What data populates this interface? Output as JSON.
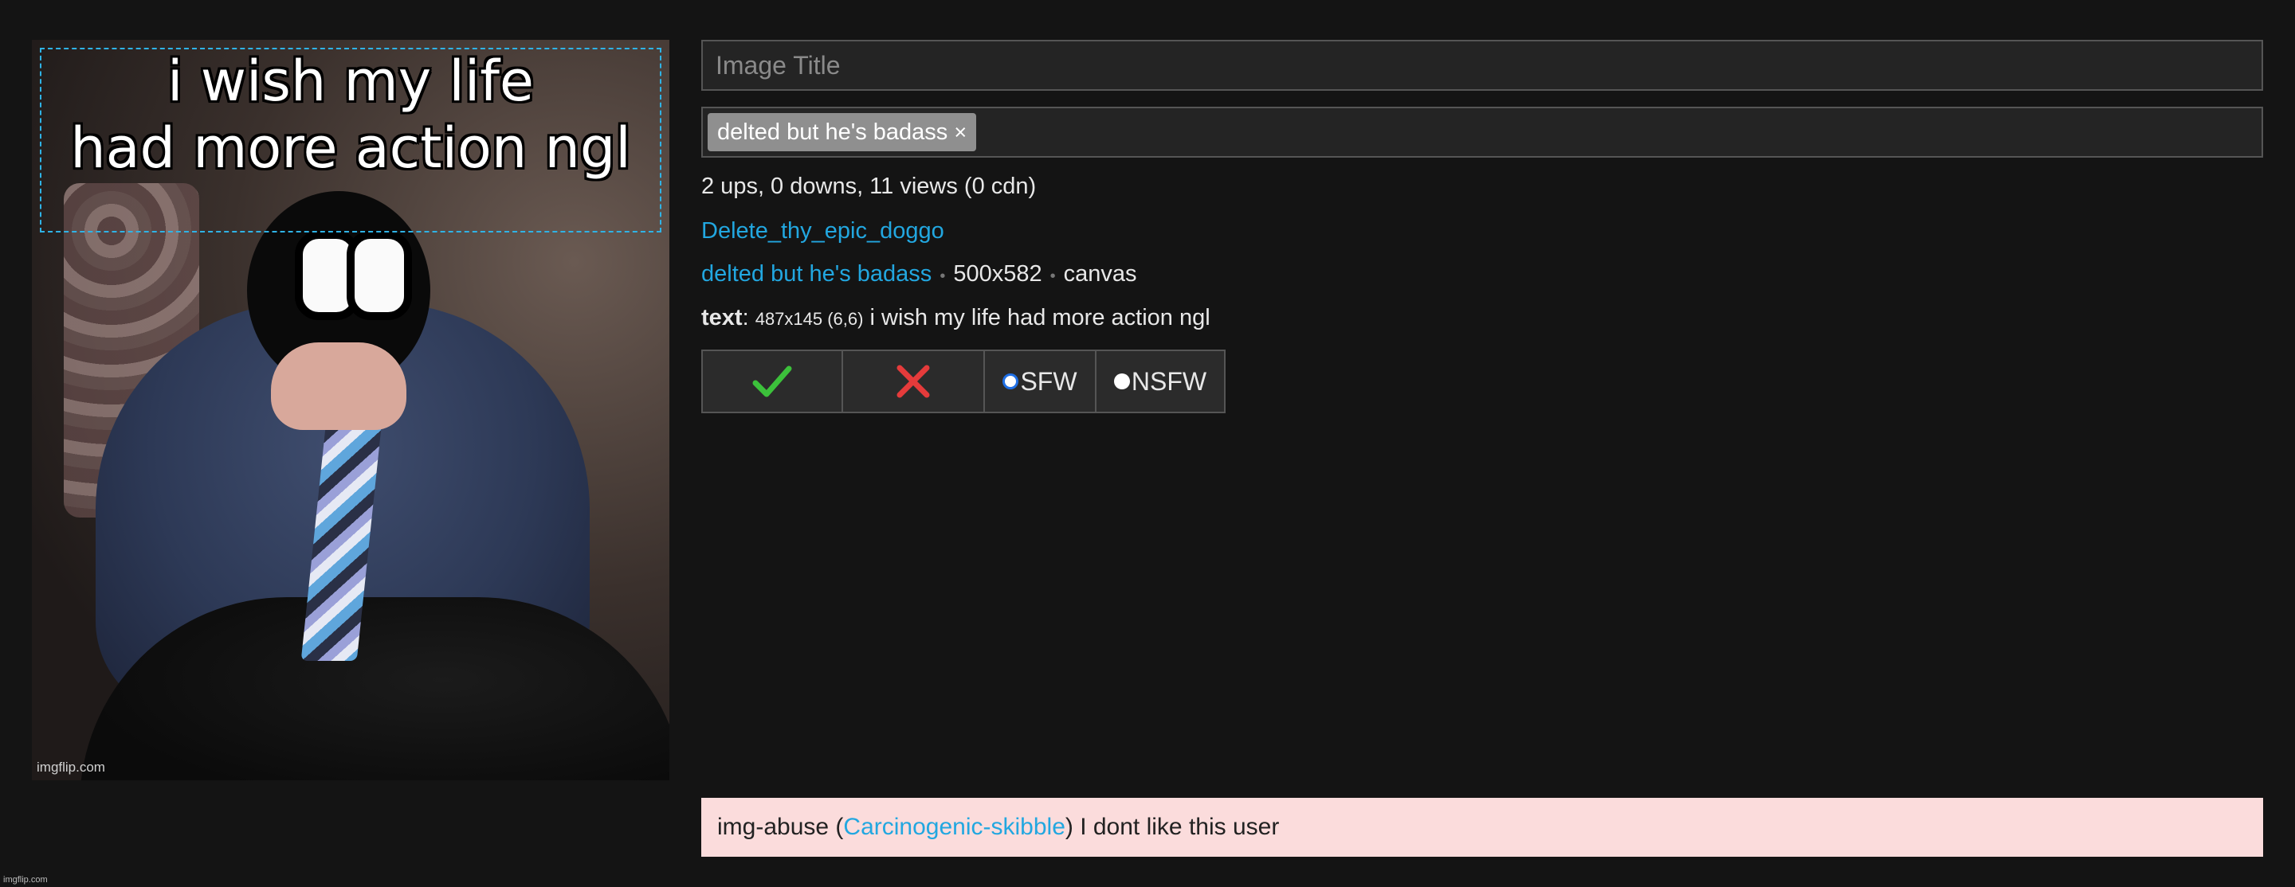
{
  "meme": {
    "caption_line1": "i wish my life",
    "caption_line2": "had more action ngl",
    "watermark": "imgflip.com"
  },
  "title_input": {
    "placeholder": "Image Title",
    "value": ""
  },
  "tags": [
    {
      "label": "delted but he's badass",
      "remove": "×"
    }
  ],
  "stats": "2 ups, 0 downs, 11 views (0 cdn)",
  "owner": "Delete_thy_epic_doggo",
  "meta": {
    "template": "delted but he's badass",
    "separator": "•",
    "size": "500x582",
    "type": "canvas"
  },
  "text_info": {
    "label": "text",
    "colon": ":",
    "dims": "487x145 (6,6)",
    "content": "i wish my life had more action ngl"
  },
  "buttons": {
    "approve_icon": "check-icon",
    "reject_icon": "cross-icon",
    "sfw_label": "SFW",
    "nsfw_label": "NSFW",
    "selected": "SFW"
  },
  "report": {
    "prefix": "img-abuse (",
    "user": "Carcinogenic-skibble",
    "suffix": ") I dont like this user"
  },
  "footer_watermark": "imgflip.com",
  "colors": {
    "background": "#141414",
    "link": "#22a7e0",
    "approve": "#3cc13b",
    "reject": "#e53b3b",
    "report_bg": "#fbdcdc"
  }
}
